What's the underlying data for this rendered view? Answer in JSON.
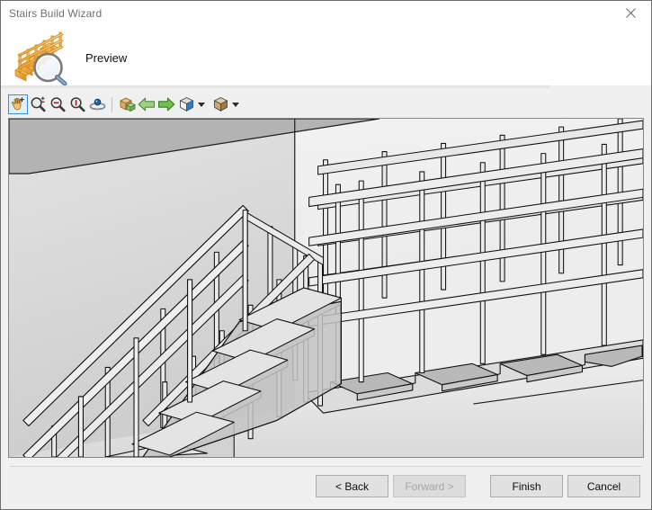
{
  "window": {
    "title": "Stairs Build Wizard",
    "close_icon": "close-icon"
  },
  "header": {
    "title": "Preview",
    "icon": "stairs-preview-icon"
  },
  "toolbar": {
    "items": [
      {
        "name": "pan-tool-button",
        "icon": "hand-pan-icon",
        "selected": true,
        "caret": false
      },
      {
        "name": "zoom-window-button",
        "icon": "zoom-plus-minus-icon",
        "selected": false,
        "caret": false
      },
      {
        "name": "zoom-out-button",
        "icon": "zoom-minus-icon",
        "selected": false,
        "caret": false
      },
      {
        "name": "zoom-extents-button",
        "icon": "zoom-one-icon",
        "selected": false,
        "caret": false
      },
      {
        "name": "orbit-button",
        "icon": "orbit-icon",
        "selected": false,
        "caret": false
      },
      {
        "name": "separator-1",
        "icon": "separator",
        "selected": false,
        "caret": false
      },
      {
        "name": "add-component-button",
        "icon": "box-plus-icon",
        "selected": false,
        "caret": false
      },
      {
        "name": "view-back-button",
        "icon": "arrow-left-icon",
        "selected": false,
        "caret": false
      },
      {
        "name": "view-forward-button",
        "icon": "arrow-right-icon",
        "selected": false,
        "caret": false
      },
      {
        "name": "view-cube-button",
        "icon": "view-cube-icon",
        "selected": false,
        "caret": true
      },
      {
        "name": "render-mode-button",
        "icon": "shaded-box-icon",
        "selected": false,
        "caret": true
      }
    ]
  },
  "preview": {
    "name": "stairs-3d-preview",
    "description": "3D shaded wireframe preview of a staircase with railings, landing and treads"
  },
  "footer": {
    "back_label": "< Back",
    "forward_label": "Forward >",
    "forward_disabled": true,
    "finish_label": "Finish",
    "cancel_label": "Cancel"
  },
  "colors": {
    "accent_selection": "#3c8ddb",
    "window_bg": "#f0f0f0",
    "titlebar_text": "#6f6f6f",
    "icon_gold": "#f2a93b",
    "viewport_bg": "#d9d9d9"
  }
}
